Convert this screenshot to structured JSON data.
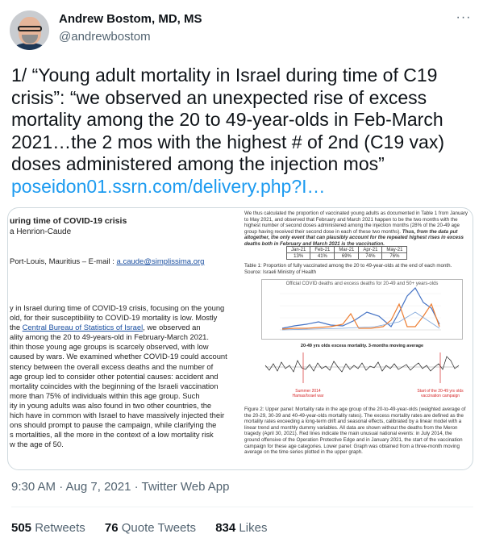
{
  "author": {
    "name": "Andrew Bostom, MD, MS",
    "handle": "@andrewbostom"
  },
  "more_label": "···",
  "tweet": {
    "text": "1/ “Young adult mortality in Israel during time of C19 crisis”: “we observed an unexpected rise of excess mortality among the 20 to 49-year-olds in Feb-March 2021…the 2 mos with the highest # of 2nd (C19 vax) doses administered among the injection mos”",
    "link": "poseidon01.ssrn.com/delivery.php?I…"
  },
  "paper_left": {
    "title": "uring time of COVID-19 crisis",
    "author": "a Henrion-Caude",
    "affil_prefix": "Port-Louis, Mauritius – E-mail : ",
    "email": "a.caude@simplissima.org",
    "body_lines": [
      "y in Israel during time of COVID-19 crisis, focusing on the young",
      "old, for their susceptibility to COVID-19 mortality is low. Mostly",
      "the ",
      "Central Bureau of Statistics of Israel",
      ", we observed an",
      "ality among the 20 to 49-years-old in February-March 2021.",
      "ithin those young age groups is scarcely observed, with low",
      "caused by wars. We examined whether COVID-19 could account",
      "stency between the overall excess deaths and the number of",
      "age group led to consider other potential causes: accident and",
      "mortality coincides with the beginning of the Israeli vaccination",
      "more than 75% of individuals within this age group. Such",
      "ity in young adults was also found in two other countries, the",
      "hich have in common with Israel to have massively injected their",
      "ons should prompt to pause the campaign, while clarifying the",
      "s mortalities, all the more in the context of a low mortality risk",
      "w the age of 50."
    ]
  },
  "paper_right": {
    "intro": "We thus calculated the proportion of vaccinated young adults as documented in Table 1 from January to May 2021, and observed that February and March 2021 happen to be the two months with the highest number of second doses administered among the injection months (28% of the 20-49 age group having received their second dose in each of these two months). ",
    "intro_bold": "Thus, from the data put altogether, the only event that can plausibly account for the repeated highest rises in excess deaths both in February and March 2021 is the vaccination.",
    "table_headers": [
      "Jan-21",
      "Feb-21",
      "Mar-21",
      "Apr-21",
      "May-21"
    ],
    "table_values": [
      "13%",
      "41%",
      "69%",
      "74%",
      "76%"
    ],
    "caption": "Table 1: Proportion of fully vaccinated among the 20 to 49-year-olds at the end of each month. Source: Israeli Ministry of Health",
    "chart1_title": "Official COVID deaths and excess deaths for 20-49 and 50+ years-olds",
    "chart2_title": "20-49 yrs olds excess mortality. 3-months moving average",
    "annot1": "Summer 2014 Hamas/Israel war",
    "annot2": "Start of the 20-49 yrs olds vaccination campaign",
    "figure_caption": "Figure 2: Upper panel: Mortality rate in the age group of the 20-to-49-year-olds (weighted average of the 20-29, 30-39 and 40-49-year-olds mortality rates). The excess mortality rates are defined as the mortality rates exceeding a long-term drift and seasonal effects, calibrated by a linear model with a linear trend and monthly dummy variables. All data are shown without the deaths from the Meron tragedy (April 30, 2021). Red lines indicate the main unusual national events: in July 2014, the ground offensive of the Operation Protective Edge and in January 2021, the start of the vaccination campaign for these age categories. Lower panel: Graph was obtained from a three-month moving average on the time series plotted in the upper graph."
  },
  "meta": {
    "time": "9:30 AM · Aug 7, 2021 · Twitter Web App"
  },
  "stats": {
    "retweets_count": "505",
    "retweets_label": "Retweets",
    "quotes_count": "76",
    "quotes_label": "Quote Tweets",
    "likes_count": "834",
    "likes_label": "Likes"
  },
  "colors": {
    "link": "#1d9bf0",
    "secondary_text": "#536471",
    "primary_text": "#0f1419",
    "chart_blue": "#4472c4",
    "chart_orange": "#ed7d31",
    "chart_red": "#d62728"
  }
}
